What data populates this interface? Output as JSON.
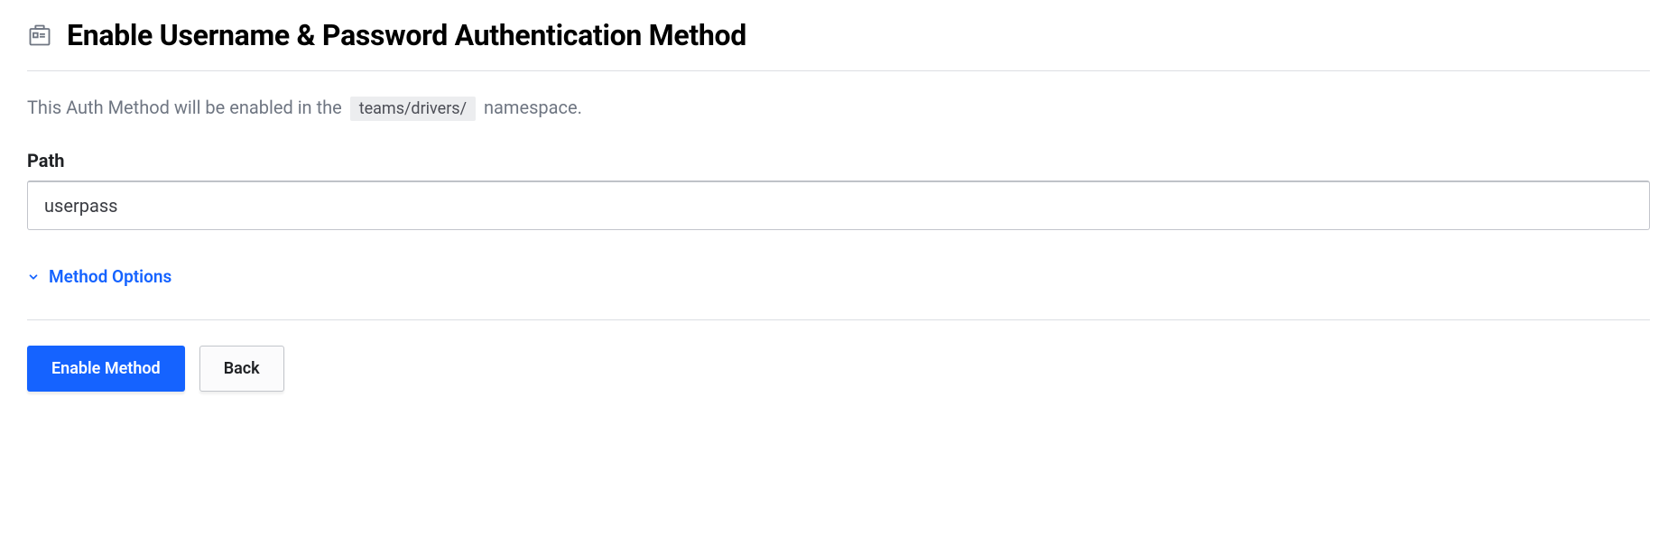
{
  "header": {
    "title": "Enable Username & Password Authentication Method"
  },
  "namespace_info": {
    "prefix": "This Auth Method will be enabled in the ",
    "badge": "teams/drivers/",
    "suffix": " namespace."
  },
  "form": {
    "path_label": "Path",
    "path_value": "userpass"
  },
  "expand": {
    "label": "Method Options"
  },
  "buttons": {
    "enable": "Enable Method",
    "back": "Back"
  }
}
